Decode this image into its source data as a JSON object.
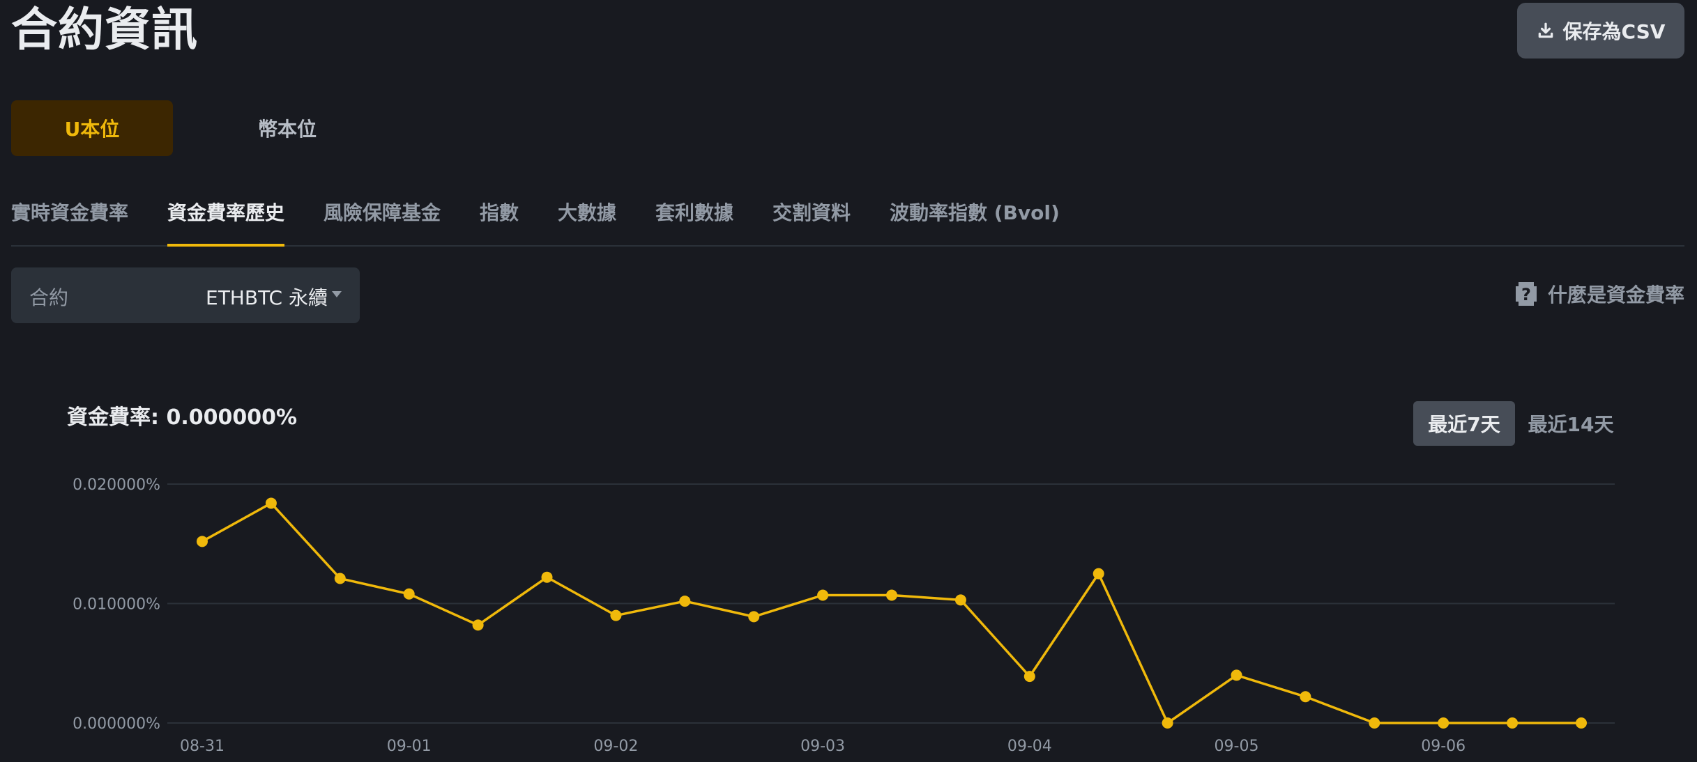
{
  "header": {
    "title": "合約資訊",
    "csv_button": "保存為CSV",
    "csv_icon": "download-icon"
  },
  "margin_mode": {
    "options": [
      "U本位",
      "幣本位"
    ],
    "selected": "U本位"
  },
  "tabs": [
    {
      "label": "實時資金費率",
      "active": false
    },
    {
      "label": "資金費率歷史",
      "active": true
    },
    {
      "label": "風險保障基金",
      "active": false
    },
    {
      "label": "指數",
      "active": false
    },
    {
      "label": "大數據",
      "active": false
    },
    {
      "label": "套利數據",
      "active": false
    },
    {
      "label": "交割資料",
      "active": false
    },
    {
      "label": "波動率指數 (Bvol)",
      "active": false
    }
  ],
  "contract": {
    "label": "合約",
    "value": "ETHBTC 永續"
  },
  "help": {
    "label": "什麼是資金費率",
    "icon": "question-icon"
  },
  "chart_header": {
    "rate_text": "資金費率: 0.000000%"
  },
  "range_buttons": {
    "options": [
      "最近7天",
      "最近14天"
    ],
    "selected": "最近7天"
  },
  "colors": {
    "accent": "#f0b90b",
    "background": "#181a20"
  },
  "chart_data": {
    "type": "line",
    "y_tick_labels": [
      "0.020000%",
      "0.010000%",
      "0.000000%"
    ],
    "x_tick_labels": [
      "08-31",
      "09-01",
      "09-02",
      "09-03",
      "09-04",
      "09-05",
      "09-06"
    ],
    "ylim": [
      0,
      0.02
    ],
    "y_unit": "%",
    "grid": true,
    "series": [
      {
        "values": [
          0.0152,
          0.0184,
          0.0121,
          0.0108,
          0.0082,
          0.0122,
          0.009,
          0.0102,
          0.0089,
          0.0107,
          0.0107,
          0.0103,
          0.0039,
          0.0125,
          0.0,
          0.004,
          0.0022,
          0.0,
          0.0,
          0.0,
          0.0
        ]
      }
    ]
  }
}
